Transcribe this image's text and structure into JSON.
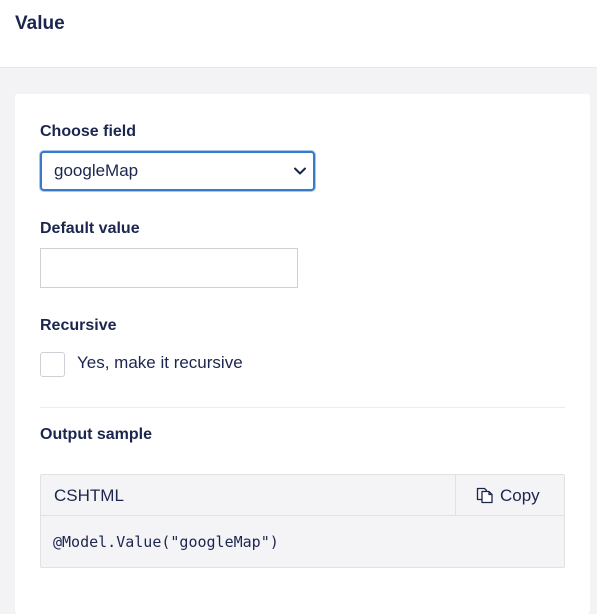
{
  "header": {
    "title": "Value"
  },
  "form": {
    "choose_field_label": "Choose field",
    "choose_field_value": "googleMap",
    "default_value_label": "Default value",
    "default_value_value": "",
    "recursive_label": "Recursive",
    "recursive_checkbox_label": "Yes, make it recursive",
    "recursive_checked": false
  },
  "output": {
    "label": "Output sample",
    "language": "CSHTML",
    "copy_label": "Copy",
    "code": "@Model.Value(\"googleMap\")"
  },
  "icons": {
    "select": "chevron-down-icon",
    "copy": "copy-icon"
  },
  "colors": {
    "text": "#1b264f",
    "focus_border": "#3879c8",
    "background": "#f3f3f5"
  }
}
